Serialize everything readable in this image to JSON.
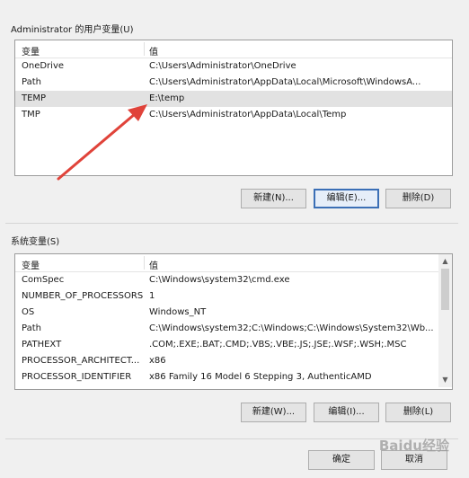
{
  "user_vars": {
    "group_label": "Administrator 的用户变量(U)",
    "columns": {
      "name": "变量",
      "value": "值"
    },
    "rows": [
      {
        "name": "OneDrive",
        "value": "C:\\Users\\Administrator\\OneDrive",
        "selected": false
      },
      {
        "name": "Path",
        "value": "C:\\Users\\Administrator\\AppData\\Local\\Microsoft\\WindowsA...",
        "selected": false
      },
      {
        "name": "TEMP",
        "value": "E:\\temp",
        "selected": true
      },
      {
        "name": "TMP",
        "value": "C:\\Users\\Administrator\\AppData\\Local\\Temp",
        "selected": false
      }
    ],
    "new_label": "新建(N)...",
    "edit_label": "编辑(E)...",
    "delete_label": "删除(D)"
  },
  "system_vars": {
    "group_label": "系统变量(S)",
    "columns": {
      "name": "变量",
      "value": "值"
    },
    "rows": [
      {
        "name": "ComSpec",
        "value": "C:\\Windows\\system32\\cmd.exe"
      },
      {
        "name": "NUMBER_OF_PROCESSORS",
        "value": "1"
      },
      {
        "name": "OS",
        "value": "Windows_NT"
      },
      {
        "name": "Path",
        "value": "C:\\Windows\\system32;C:\\Windows;C:\\Windows\\System32\\Wb..."
      },
      {
        "name": "PATHEXT",
        "value": ".COM;.EXE;.BAT;.CMD;.VBS;.VBE;.JS;.JSE;.WSF;.WSH;.MSC"
      },
      {
        "name": "PROCESSOR_ARCHITECT...",
        "value": "x86"
      },
      {
        "name": "PROCESSOR_IDENTIFIER",
        "value": "x86 Family 16 Model 6 Stepping 3, AuthenticAMD"
      }
    ],
    "new_label": "新建(W)...",
    "edit_label": "编辑(I)...",
    "delete_label": "删除(L)"
  },
  "footer": {
    "ok_label": "确定",
    "cancel_label": "取消"
  },
  "watermark": "Baidu经验",
  "colors": {
    "arrow": "#e0433a",
    "focus": "#3b6fb6"
  }
}
